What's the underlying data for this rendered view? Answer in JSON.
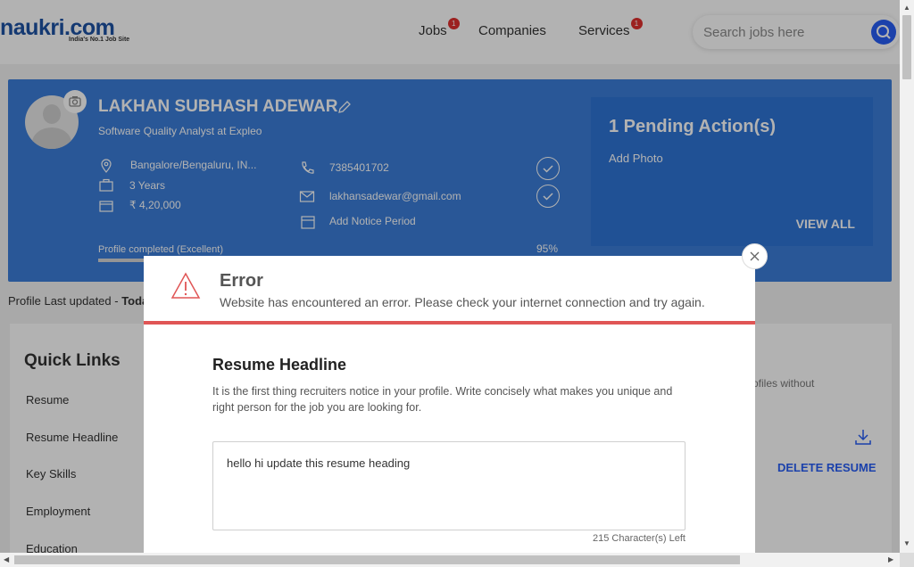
{
  "header": {
    "logo": "naukri.com",
    "logo_tagline": "India's No.1 Job Site",
    "nav": [
      {
        "label": "Jobs",
        "badge": "1"
      },
      {
        "label": "Companies",
        "badge": ""
      },
      {
        "label": "Services",
        "badge": "1"
      }
    ],
    "search_placeholder": "Search jobs here"
  },
  "profile": {
    "name": "LAKHAN SUBHASH ADEWAR",
    "role": "Software Quality Analyst at Expleo",
    "location": "Bangalore/Bengaluru, IN...",
    "experience": "3 Years",
    "salary": "₹ 4,20,000",
    "phone": "7385401702",
    "email": "lakhansadewar@gmail.com",
    "notice": "Add Notice Period",
    "progress_label": "Profile completed (Excellent)",
    "progress_percent": "95%",
    "progress_value": 0.95
  },
  "pending": {
    "title": "1 Pending Action(s)",
    "item": "Add Photo",
    "view_all": "VIEW ALL"
  },
  "last_updated": {
    "prefix": "Profile Last updated - ",
    "value": "Toda"
  },
  "quick_links": {
    "title": "Quick Links",
    "items": [
      "Resume",
      "Resume Headline",
      "Key Skills",
      "Employment",
      "Education"
    ]
  },
  "main_panel": {
    "note": "ofiles without",
    "delete_resume": "DELETE RESUME"
  },
  "modal": {
    "error_title": "Error",
    "error_message": "Website has encountered an error. Please check your internet connection and try again.",
    "headline_title": "Resume Headline",
    "headline_desc": "It is the first thing recruiters notice in your profile. Write concisely what makes you unique and right person for the job you are looking for.",
    "headline_value": "hello hi update this resume heading",
    "chars_left": "215 Character(s) Left"
  },
  "colors": {
    "brand_blue": "#275df5",
    "profile_bg": "#3b7dd8",
    "error_red": "#e05555",
    "badge_red": "#e0302f"
  }
}
